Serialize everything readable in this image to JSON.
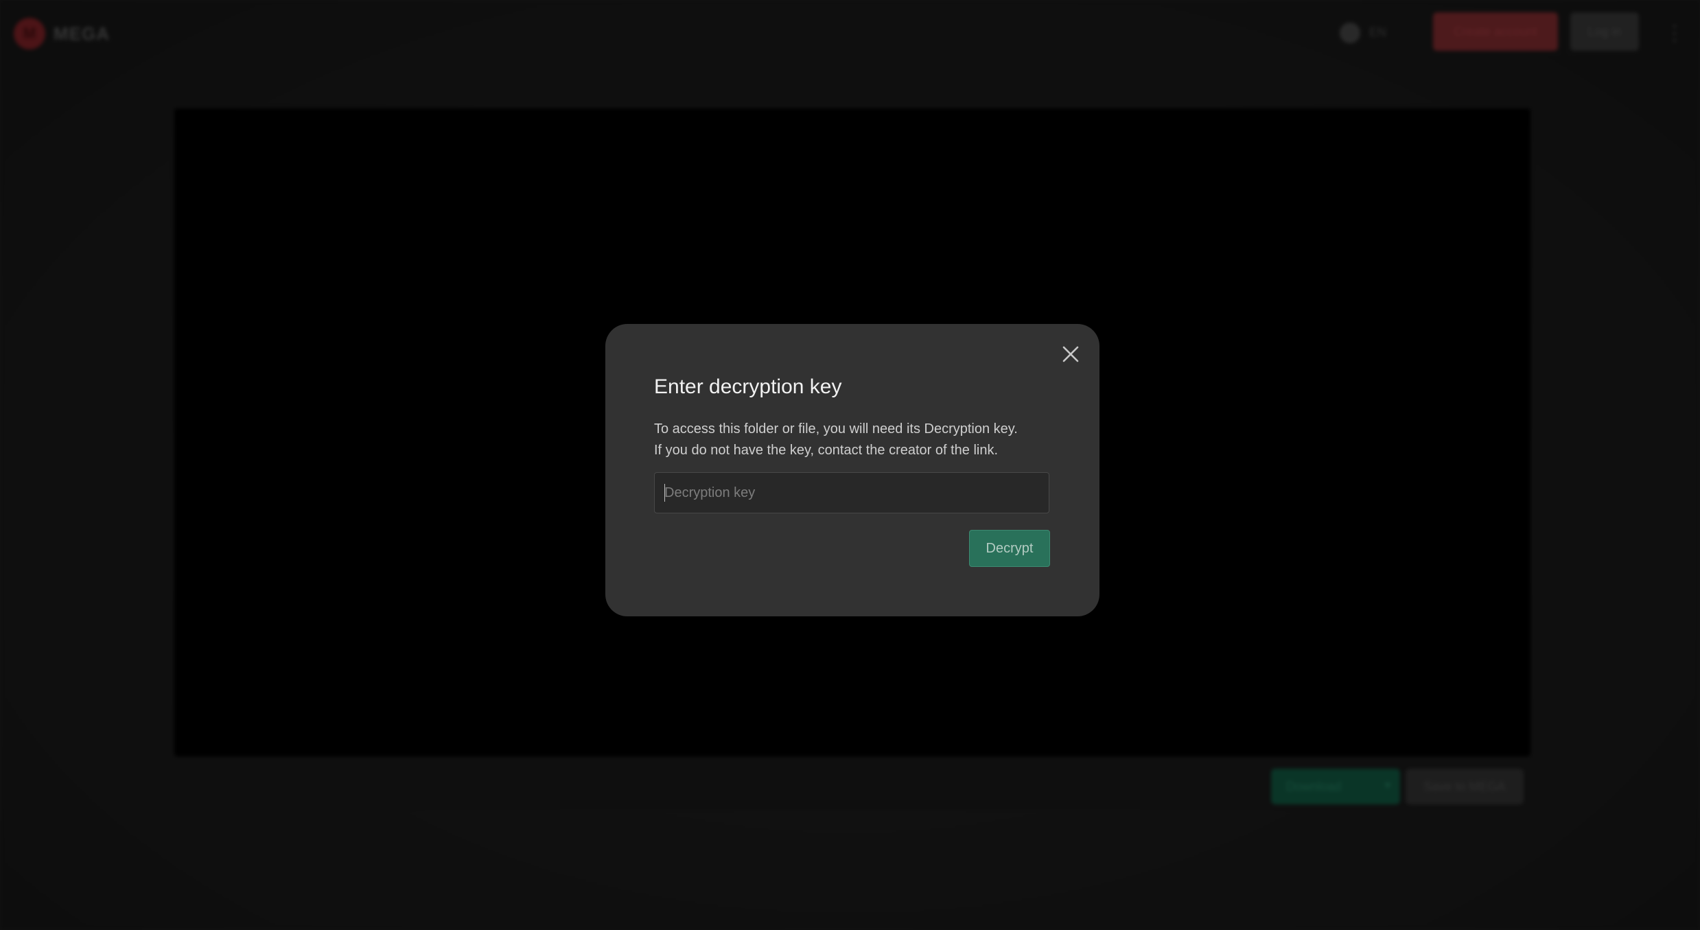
{
  "background": {
    "logo_text": "MEGA",
    "language_label": "EN",
    "create_account_label": "Create account",
    "login_label": "Log in",
    "download_label": "Download",
    "save_to_mega_label": "Save to MEGA"
  },
  "modal": {
    "title": "Enter decryption key",
    "description_line1": "To access this folder or file, you will need its Decryption key.",
    "description_line2": "If you do not have the key, contact the creator of the link.",
    "input_value": "",
    "input_placeholder": "Decryption key",
    "decrypt_label": "Decrypt"
  },
  "icons": {
    "close": "close-icon",
    "logo": "mega-logo-icon",
    "language": "globe-icon",
    "menu": "kebab-menu-icon",
    "chevron": "chevron-down-icon"
  },
  "colors": {
    "brand_red": "#d9272e",
    "accent_green": "#29715a",
    "modal_bg": "#323232"
  }
}
